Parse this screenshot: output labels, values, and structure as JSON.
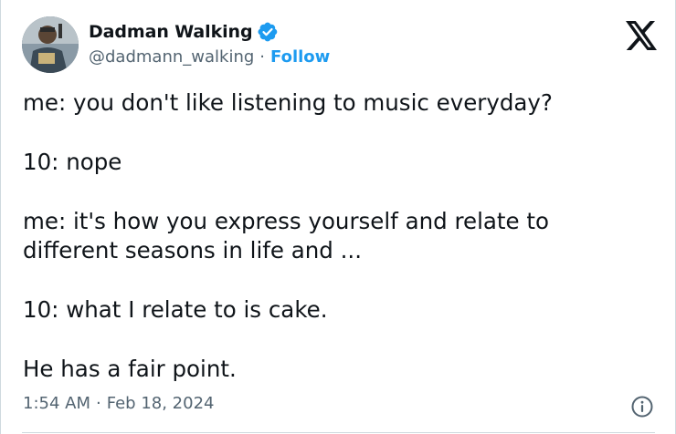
{
  "author": {
    "display_name": "Dadman Walking",
    "handle": "@dadmann_walking",
    "follow_label": "Follow",
    "separator": "·",
    "verified_color": "#1d9bf0"
  },
  "tweet": {
    "paragraphs": [
      "me: you don't like listening to music everyday?",
      "10: nope",
      "me: it's how you express yourself and relate to different seasons in life and ...",
      "10: what I relate to is cake.",
      "He has a fair point."
    ]
  },
  "meta": {
    "time": "1:54 AM",
    "separator": "·",
    "date": "Feb 18, 2024"
  },
  "icons": {
    "brand": "x-logo-icon",
    "info": "info-icon",
    "verified": "verified-badge-icon"
  },
  "colors": {
    "text_primary": "#0f1419",
    "text_secondary": "#536471",
    "accent": "#1d9bf0",
    "border": "#cfd9de"
  }
}
